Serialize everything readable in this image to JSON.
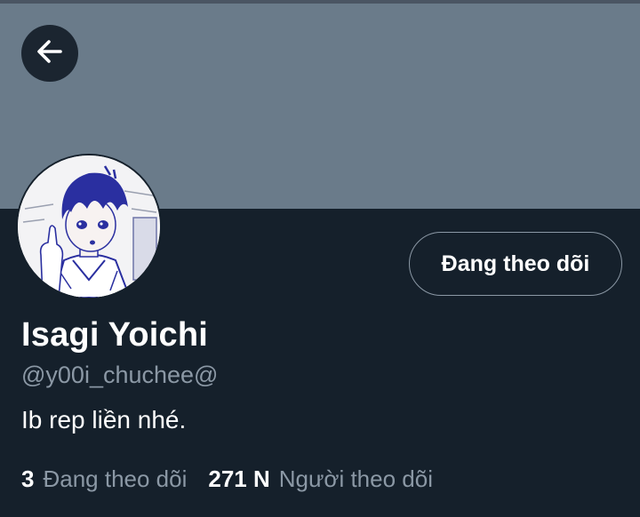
{
  "colors": {
    "background": "#15202b",
    "banner": "#6a7b8a",
    "text_primary": "#ffffff",
    "text_secondary": "#8b98a5",
    "button_border": "#8b98a5",
    "avatar_hair": "#2a2fa0"
  },
  "header": {
    "back_icon": "arrow-left-icon"
  },
  "profile": {
    "avatar_icon": "avatar-anime-illustration",
    "display_name": "Isagi Yoichi",
    "handle": "@y00i_chuchee@",
    "bio": "Ib rep liền nhé.",
    "follow_button_label": "Đang theo dõi"
  },
  "stats": {
    "following_count": "3",
    "following_label": "Đang theo dõi",
    "followers_count": "271 N",
    "followers_label": "Người theo dõi"
  }
}
